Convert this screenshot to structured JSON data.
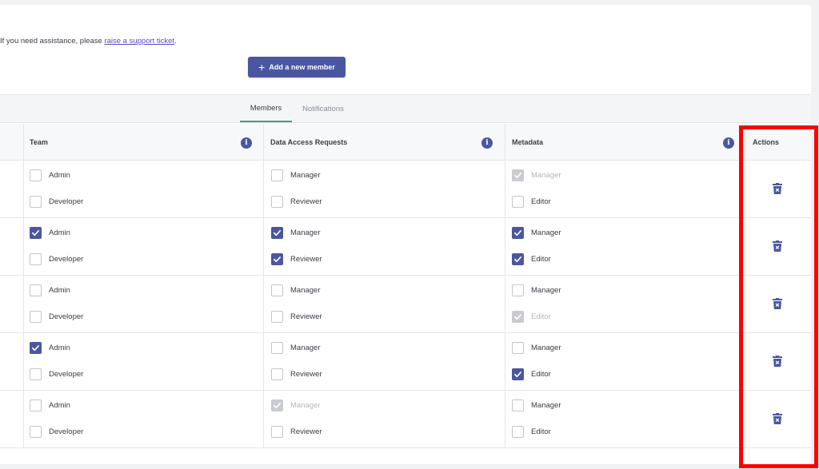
{
  "help": {
    "prefix": "If you need assistance, please ",
    "link": "raise a support ticket",
    "suffix": "."
  },
  "add_button": {
    "label": "Add a new member",
    "icon": "plus-icon"
  },
  "tabs": [
    {
      "label": "Members",
      "active": true
    },
    {
      "label": "Notifications",
      "active": false
    }
  ],
  "columns": {
    "team": "Team",
    "data_access_requests": "Data Access Requests",
    "metadata": "Metadata",
    "actions": "Actions"
  },
  "labels": {
    "admin": "Admin",
    "developer": "Developer",
    "manager": "Manager",
    "reviewer": "Reviewer",
    "editor": "Editor"
  },
  "colors": {
    "accent": "#4a57a0",
    "tab_underline": "#3ba37a",
    "highlight": "#ff0000"
  },
  "rows": [
    {
      "team": {
        "admin": "unchecked",
        "developer": "unchecked"
      },
      "dar": {
        "manager": "unchecked",
        "reviewer": "unchecked"
      },
      "metadata": {
        "manager": "disabled",
        "editor": "unchecked"
      }
    },
    {
      "team": {
        "admin": "checked",
        "developer": "unchecked"
      },
      "dar": {
        "manager": "checked",
        "reviewer": "checked"
      },
      "metadata": {
        "manager": "checked",
        "editor": "checked"
      }
    },
    {
      "team": {
        "admin": "unchecked",
        "developer": "unchecked"
      },
      "dar": {
        "manager": "unchecked",
        "reviewer": "unchecked"
      },
      "metadata": {
        "manager": "unchecked",
        "editor": "disabled"
      }
    },
    {
      "team": {
        "admin": "checked",
        "developer": "unchecked"
      },
      "dar": {
        "manager": "unchecked",
        "reviewer": "unchecked"
      },
      "metadata": {
        "manager": "unchecked",
        "editor": "checked"
      }
    },
    {
      "team": {
        "admin": "unchecked",
        "developer": "unchecked"
      },
      "dar": {
        "manager": "disabled",
        "reviewer": "unchecked"
      },
      "metadata": {
        "manager": "unchecked",
        "editor": "unchecked"
      }
    }
  ]
}
